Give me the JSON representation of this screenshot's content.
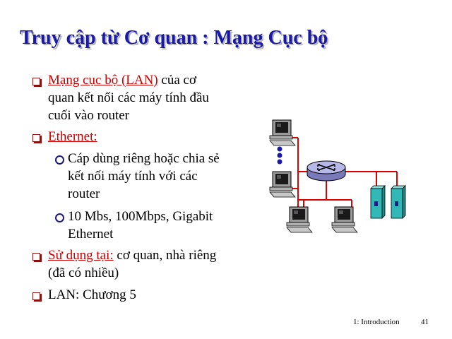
{
  "slide": {
    "title": "Truy cập từ Cơ quan : Mạng Cục bộ",
    "bullets": [
      {
        "highlight": "Mạng cục bộ (LAN)",
        "rest_line1": " của cơ",
        "line2": "quan kết nối các máy tính đầu",
        "line3": "cuối vào router"
      },
      {
        "highlight": "Ethernet:"
      },
      {
        "highlight": "Sử dụng tại:",
        "rest_line1": " cơ quan, nhà riêng",
        "line2": "(đã có nhiều)"
      },
      {
        "text": "LAN:  Chương 5"
      }
    ],
    "sub_bullets": [
      {
        "line1": "Cáp dùng riêng hoặc chia sẻ",
        "line2": "kết nối máy tính với các",
        "line3": "router"
      },
      {
        "line1": "10 Mbs, 100Mbps, Gigabit",
        "line2": "Ethernet"
      }
    ]
  },
  "footer": {
    "section": "1: Introduction",
    "page_number": "41"
  },
  "diagram": {
    "link_color": "#dd0000",
    "router_color": "#b8b8e8",
    "server_color": "#33b8b8",
    "dots_color": "#1a1aa6"
  }
}
